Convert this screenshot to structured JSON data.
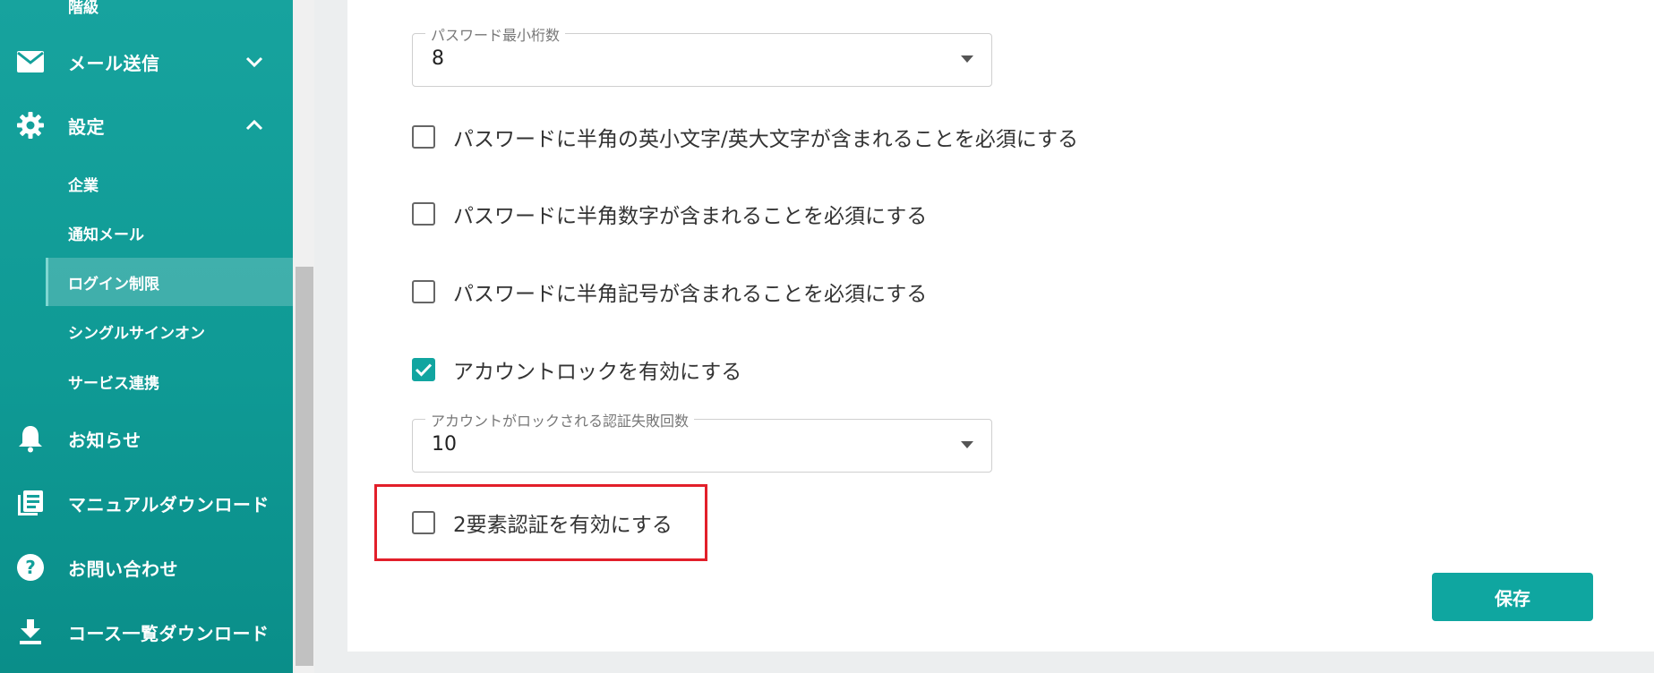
{
  "sidebar": {
    "clipped_item_label": "階級",
    "items": [
      {
        "label": "メール送信",
        "icon": "mail-icon",
        "chevron": "down"
      },
      {
        "label": "設定",
        "icon": "gear-icon",
        "chevron": "up"
      },
      {
        "label": "お知らせ",
        "icon": "bell-icon"
      },
      {
        "label": "マニュアルダウンロード",
        "icon": "manual-icon"
      },
      {
        "label": "お問い合わせ",
        "icon": "help-icon"
      },
      {
        "label": "コース一覧ダウンロード",
        "icon": "download-icon"
      }
    ],
    "settings_sub_items": [
      {
        "label": "企業"
      },
      {
        "label": "通知メール"
      },
      {
        "label": "ログイン制限",
        "active": true
      },
      {
        "label": "シングルサインオン"
      },
      {
        "label": "サービス連携"
      }
    ]
  },
  "form": {
    "password_min_length": {
      "label": "パスワード最小桁数",
      "value": "8"
    },
    "require_case": {
      "label": "パスワードに半角の英小文字/英大文字が含まれることを必須にする",
      "checked": false
    },
    "require_digit": {
      "label": "パスワードに半角数字が含まれることを必須にする",
      "checked": false
    },
    "require_symbol": {
      "label": "パスワードに半角記号が含まれることを必須にする",
      "checked": false
    },
    "account_lock": {
      "label": "アカウントロックを有効にする",
      "checked": true
    },
    "lock_attempts": {
      "label": "アカウントがロックされる認証失敗回数",
      "value": "10"
    },
    "two_factor": {
      "label": "2要素認証を有効にする",
      "checked": false
    },
    "save_label": "保存"
  },
  "colors": {
    "accent": "#11a5a0",
    "highlight": "#e21f2a"
  }
}
